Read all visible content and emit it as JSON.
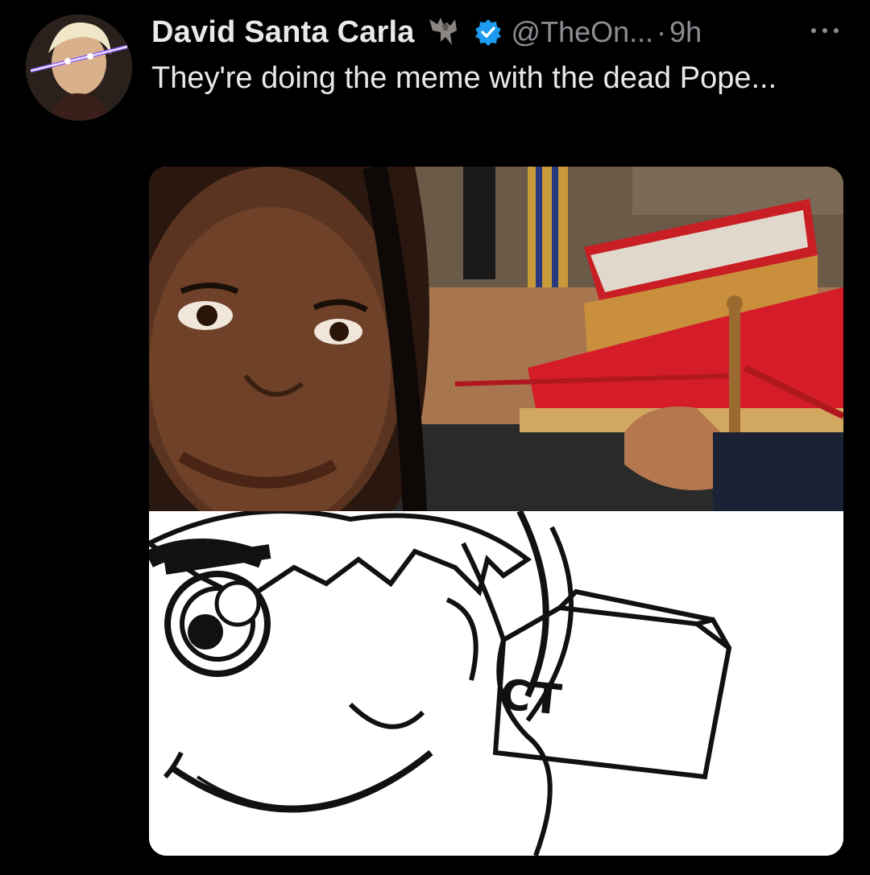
{
  "tweet": {
    "display_name": "David Santa Carla",
    "handle": "@TheOn...",
    "separator": "·",
    "time": "9h",
    "text": "They're doing the meme with the dead Pope...",
    "icons": {
      "name_emoji": "bat-icon",
      "verified": "verified-icon",
      "more": "more-icon"
    }
  },
  "media": {
    "box_label": "CT"
  },
  "colors": {
    "background": "#000000",
    "name": "#e7e9ea",
    "secondary": "#8b8f94",
    "verified": "#1d9bf0"
  }
}
